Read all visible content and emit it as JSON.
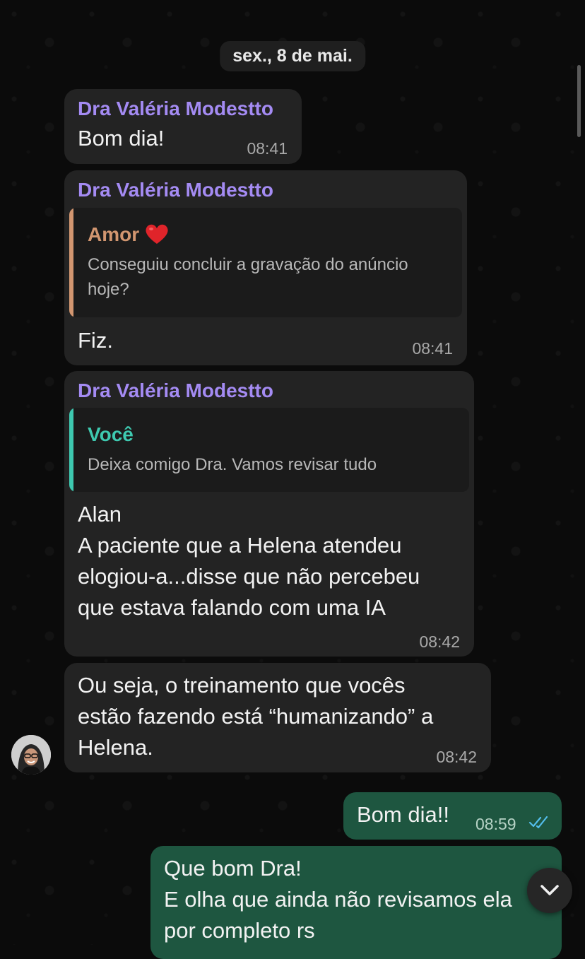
{
  "date_divider": "sex., 8 de mai.",
  "messages": [
    {
      "sender": "Dra Valéria Modestto",
      "text": "Bom dia!",
      "time": "08:41"
    },
    {
      "sender": "Dra Valéria Modestto",
      "quote": {
        "name": "Amor",
        "emoji_icon": "red-heart-icon",
        "text": "Conseguiu concluir a gravação do anúncio\nhoje?",
        "color": "#d29670"
      },
      "text": "Fiz.",
      "time": "08:41"
    },
    {
      "sender": "Dra Valéria Modestto",
      "quote": {
        "name": "Você",
        "text": "Deixa comigo Dra. Vamos revisar tudo",
        "color": "#3ec9b0"
      },
      "text": "Alan\nA paciente que a Helena atendeu\nelogiou-a...disse que não percebeu\nque estava falando com uma IA",
      "time": "08:42"
    },
    {
      "text": "Ou seja, o treinamento que vocês\nestão fazendo está “humanizando” a\nHelena.",
      "time": "08:42"
    },
    {
      "text": "Bom dia!!",
      "time": "08:59",
      "status_icon": "double-check-read-icon"
    },
    {
      "text": "Que bom Dra!\nE olha que ainda não revisamos ela\npor completo rs"
    }
  ],
  "colors": {
    "sender_name": "#a48bf3",
    "incoming_bubble": "#232323",
    "outgoing_bubble": "#1e5640",
    "read_check": "#53bdeb"
  },
  "icons": {
    "scroll_down": "chevron-down-icon",
    "contact_avatar": "avatar"
  }
}
